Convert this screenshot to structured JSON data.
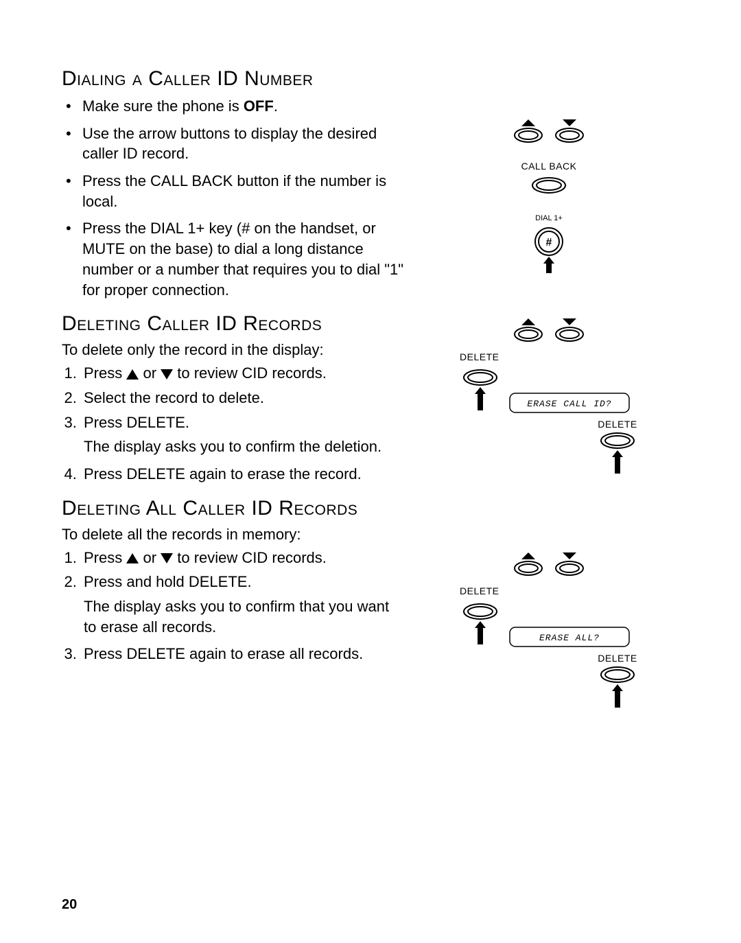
{
  "page_number": "20",
  "section1": {
    "heading": "Dialing  a Caller ID Number",
    "bullets": [
      {
        "pre": "Make sure the phone is ",
        "bold": "OFF",
        "post": "."
      },
      {
        "text": "Use the arrow buttons to display the desired caller ID record."
      },
      {
        "text": "Press the CALL BACK button if the number is local."
      },
      {
        "text": "Press the DIAL 1+ key (# on the handset, or MUTE on the base) to dial a long distance number or a number that requires you to dial \"1\" for proper connection."
      }
    ]
  },
  "section2": {
    "heading": "Deleting  Caller ID Records",
    "intro": "To delete only the record in the display:",
    "steps": [
      {
        "pre": "Press ",
        "mid": " or ",
        "post": " to review CID records."
      },
      {
        "text": "Select the record to delete."
      },
      {
        "text": "Press DELETE.",
        "sub": "The display asks you to confirm the deletion."
      },
      {
        "text": "Press DELETE again to erase the record."
      }
    ]
  },
  "section3": {
    "heading": "Deleting  All  Caller ID Records",
    "intro": "To delete all the records in memory:",
    "steps": [
      {
        "pre": "Press ",
        "mid": "  or ",
        "post": " to review CID records."
      },
      {
        "text": "Press and hold DELETE.",
        "sub": "The display asks you to confirm that you want to erase all records."
      },
      {
        "text": "Press DELETE again to erase all records."
      }
    ]
  },
  "labels": {
    "call_back": "CALL BACK",
    "dial1": "DIAL 1+",
    "hash": "#",
    "delete": "DELETE",
    "erase_call_id": "ERASE CALL ID?",
    "erase_all": "ERASE ALL?"
  }
}
